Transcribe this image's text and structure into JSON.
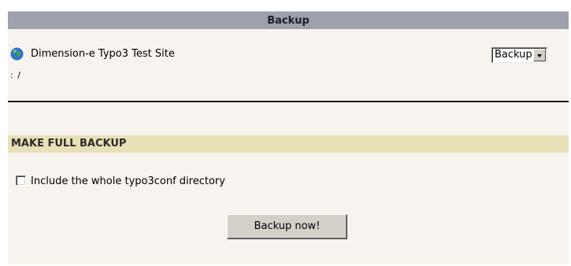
{
  "header": {
    "title": "Backup"
  },
  "site": {
    "icon": "globe-icon",
    "name": "Dimension-e Typo3 Test Site",
    "path": ": /"
  },
  "function_menu": {
    "selected": "Backup"
  },
  "section": {
    "title": "MAKE FULL BACKUP"
  },
  "options": {
    "include_typo3conf_label": "Include the whole typo3conf directory",
    "include_typo3conf_checked": false
  },
  "actions": {
    "backup_now_label": "Backup now!"
  },
  "colors": {
    "header_bar": "#9ea1ac",
    "section_bar": "#e8e0b6",
    "panel_bg": "#f7f3ef"
  }
}
